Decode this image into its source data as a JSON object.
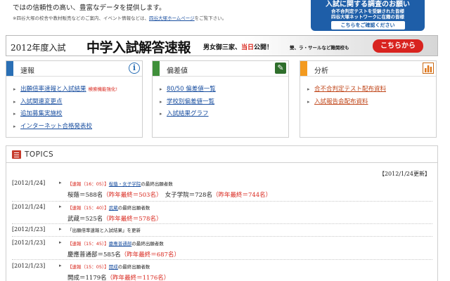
{
  "intro": {
    "line1": "ではの信頼性の高い、豊富なデータを提供します。",
    "line2_pre": "※四谷大塚の校舎や教材販売などのご案内、イベント情報などは、",
    "line2_link": "四谷大塚ホームページ",
    "line2_post": "をご覧下さい。"
  },
  "survey": {
    "title": "入試に関する調査のお願い",
    "line1": "合不合判定テストを受験された皆様",
    "line2": "四谷大塚ネットワークに在籍の皆様",
    "button": "こちらをご確認ください"
  },
  "banner": {
    "year": "2012年度入試",
    "title": "中学入試解答速報",
    "sub_a": "男女御三家、",
    "sub_red": "当日",
    "sub_b": "公開！",
    "sub2": "雙、ラ・サールなど難関校も",
    "button": "こちらから"
  },
  "boxes": {
    "news": {
      "title": "速報",
      "icon": "info-icon",
      "items": [
        {
          "label": "出願倍率速報と入試結果",
          "note": "検索機能強化!"
        },
        {
          "label": "入試関連変更点"
        },
        {
          "label": "追加募集実施校"
        },
        {
          "label": "インターネット合格発表校"
        }
      ]
    },
    "hensachi": {
      "title": "偏差値",
      "icon": "pencil-icon",
      "items": [
        {
          "label": "80/50 偏差値一覧"
        },
        {
          "label": "学校別偏差値一覧"
        },
        {
          "label": "入試結果グラフ"
        }
      ]
    },
    "bunseki": {
      "title": "分析",
      "icon": "bar-chart-icon",
      "items": [
        {
          "label": "合不合判定テスト配布資料"
        },
        {
          "label": "入試報告会配布資料"
        }
      ]
    }
  },
  "topics": {
    "title": "TOPICS",
    "updated": "【2012/1/24更新】",
    "items": [
      {
        "date": "[2012/1/24]",
        "head_red": "【速報（16：05）】",
        "head_link": "桜蔭・女子学院",
        "head_post": "の最終出願者数",
        "v1": "桜蔭＝588名",
        "v1r": "（昨年最終＝503名）",
        "v2": "　女子学院＝728名",
        "v2r": "（昨年最終＝744名）"
      },
      {
        "date": "[2012/1/24]",
        "head_red": "【速報（15：40）】",
        "head_link": "武蔵",
        "head_post": "の最終出願者数",
        "v1": "武蔵＝525名",
        "v1r": "（昨年最終＝578名）",
        "v2": "",
        "v2r": ""
      },
      {
        "date": "[2012/1/23]",
        "head_red": "",
        "head_link": "",
        "head_post": "「出願倍率速報と入試結果」を更新",
        "v1": "",
        "v1r": "",
        "v2": "",
        "v2r": ""
      },
      {
        "date": "[2012/1/23]",
        "head_red": "【速報（15：45）】",
        "head_link": "慶應普通部",
        "head_post": "の最終出願者数",
        "v1": "慶應普通部＝585名",
        "v1r": "（昨年最終＝687名）",
        "v2": "",
        "v2r": ""
      },
      {
        "date": "[2012/1/23]",
        "head_red": "【速報（15：05）】",
        "head_link": "開成",
        "head_post": "の最終出願者数",
        "v1": "開成＝1179名",
        "v1r": "（昨年最終＝1176名）",
        "v2": "",
        "v2r": ""
      }
    ]
  }
}
